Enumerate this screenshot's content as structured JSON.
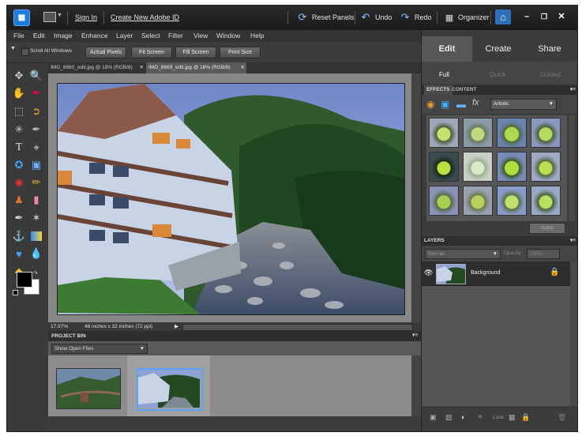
{
  "titlebar": {
    "sign_in": "Sign In",
    "create_id": "Create New Adobe ID",
    "reset_panels": "Reset Panels",
    "undo": "Undo",
    "redo": "Redo",
    "organizer": "Organizer"
  },
  "menu": [
    "File",
    "Edit",
    "Image",
    "Enhance",
    "Layer",
    "Select",
    "Filter",
    "View",
    "Window",
    "Help"
  ],
  "options": {
    "scroll_all_windows": "Scroll All Windows",
    "actual_pixels": "Actual Pixels",
    "fit_screen": "Fit Screen",
    "fill_screen": "Fill Screen",
    "print_size": "Print Size"
  },
  "doc_tabs": [
    {
      "label": "IMG_8660_edit.jpg @ 18% (RGB/8)"
    },
    {
      "label": "IMG_8669_edit.jpg @ 18% (RGB/8)"
    }
  ],
  "status": {
    "zoom": "17.97%",
    "info": "48 inches x 32 inches (72 ppi)"
  },
  "project_bin": {
    "title": "PROJECT BIN",
    "dropdown": "Show Open Files"
  },
  "right_panel": {
    "tabs": [
      "Edit",
      "Create",
      "Share"
    ],
    "sub_tabs": [
      "Full",
      "Quick",
      "Guided"
    ],
    "effects_tab": "EFFECTS",
    "content_tab": "CONTENT",
    "effects_category": "Artistic",
    "apply_label": "Apply",
    "layers_title": "LAYERS",
    "blend_mode": "Normal",
    "opacity_label": "Opacity:",
    "opacity_value": "100%",
    "layer_name": "Background",
    "lock_label": "Lock:"
  },
  "colors": {
    "accent": "#1f7bd8",
    "panel": "#3c3c3c",
    "canvas": "#888888"
  }
}
